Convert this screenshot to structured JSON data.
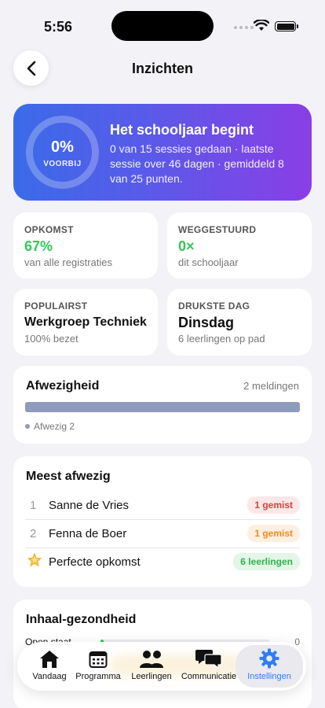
{
  "status": {
    "time": "5:56"
  },
  "nav": {
    "title": "Inzichten",
    "back_icon": "chevron-left-icon"
  },
  "hero": {
    "percent": "0%",
    "percent_label": "VOORBIJ",
    "progress": 0,
    "title": "Het schooljaar begint",
    "description": "0 van 15 sessies gedaan · laatste sessie over 46 dagen · gemiddeld 8 van 25 punten.",
    "colors": {
      "start": "#3a6be8",
      "end": "#8a3ee6"
    }
  },
  "stats": [
    {
      "label": "OPKOMST",
      "value": "67%",
      "sub": "van alle registraties",
      "value_color": "green"
    },
    {
      "label": "WEGGESTUURD",
      "value": "0×",
      "sub": "dit schooljaar",
      "value_color": "green"
    },
    {
      "label": "POPULAIRST",
      "value": "Werkgroep Techniek",
      "sub": "100% bezet"
    },
    {
      "label": "DRUKSTE DAG",
      "value": "Dinsdag",
      "sub": "6 leerlingen op pad"
    }
  ],
  "absence": {
    "title": "Afwezigheid",
    "count": "2 meldingen",
    "legend": "Afwezig 2",
    "fraction": 1.0,
    "color": "#8e9bbd"
  },
  "most_absent": {
    "title": "Meest afwezig",
    "rows": [
      {
        "rank": "1",
        "name": "Sanne de Vries",
        "badge": "1 gemist"
      },
      {
        "rank": "2",
        "name": "Fenna de Boer",
        "badge": "1 gemist"
      }
    ],
    "perfect": {
      "icon": "star-icon",
      "name": "Perfecte opkomst",
      "badge": "6 leerlingen"
    }
  },
  "catchup": {
    "title": "Inhaal-gezondheid",
    "rows": [
      {
        "label": "Open staat",
        "value": "0"
      }
    ]
  },
  "tabs": [
    {
      "label": "Vandaag",
      "icon": "house-icon"
    },
    {
      "label": "Programma",
      "icon": "calendar-icon"
    },
    {
      "label": "Leerlingen",
      "icon": "people-icon"
    },
    {
      "label": "Communicatie",
      "icon": "chat-bubbles-icon"
    },
    {
      "label": "Instellingen",
      "icon": "gear-icon",
      "active": true
    }
  ],
  "accent": "#2f7df6"
}
